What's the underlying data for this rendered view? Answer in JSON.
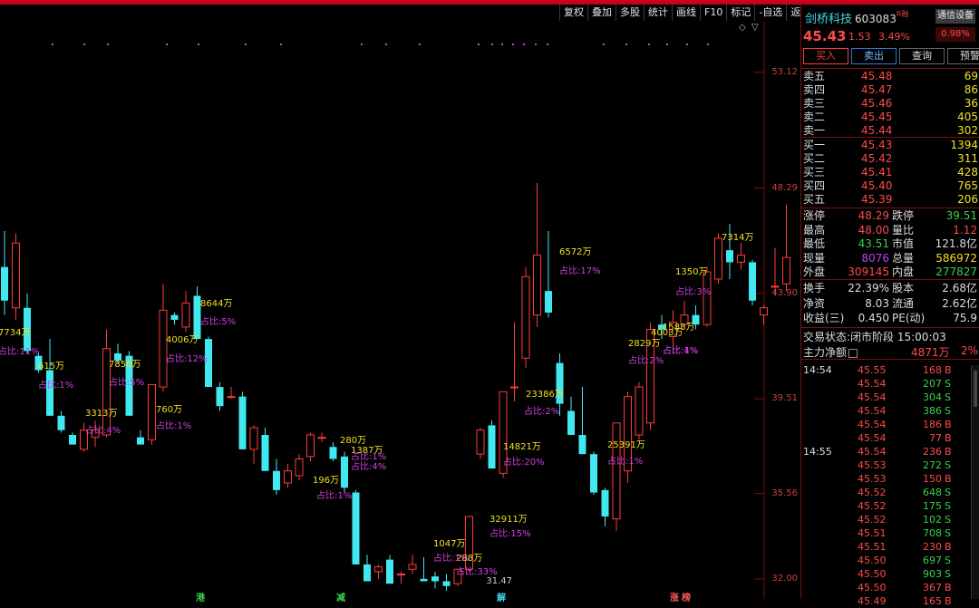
{
  "toolbar": [
    "复权",
    "叠加",
    "多股",
    "统计",
    "画线",
    "F10",
    "标记",
    "-自选",
    "返回"
  ],
  "chart": {
    "y_axis": [
      "53.12",
      "48.29",
      "43.90",
      "39.51",
      "35.56",
      "32.00"
    ],
    "low_label": "31.47",
    "bottom_markers": [
      {
        "text": "港",
        "color": "#3ad24a"
      },
      {
        "text": "减",
        "color": "#3ad24a"
      },
      {
        "text": "解",
        "color": "#42d9e8"
      },
      {
        "text": "涨",
        "color": "#ff5a5a"
      },
      {
        "text": "榜",
        "color": "#ff5a5a"
      }
    ],
    "annotations_vol": [
      "7734万",
      "615万",
      "7858万",
      "3313万",
      "760万",
      "4006万",
      "8644万",
      "280万",
      "1387万",
      "196万",
      "1047万",
      "288万",
      "32911万",
      "14821万",
      "23386万",
      "6572万",
      "25391万",
      "2829万",
      "4003万",
      "1588万",
      "1350万",
      "7314万"
    ],
    "annotations_pct": [
      "占比:11%",
      "占比:1%",
      "占比:5%",
      "占比:4%",
      "占比:1%",
      "占比:12%",
      "占比:5%",
      "占比:1%",
      "占比:4%",
      "占比:1%",
      "占比:1%",
      "占比:33%",
      "占比:15%",
      "占比:20%",
      "占比:2%",
      "占比:17%",
      "占比:1%",
      "占比:2%",
      "占比:1%",
      "占比:4%",
      "占比:3%"
    ]
  },
  "chart_data": {
    "type": "candlestick",
    "ylim": [
      31.2,
      55.0
    ],
    "candles": [
      {
        "o": 45.0,
        "h": 46.5,
        "l": 43.0,
        "c": 43.6
      },
      {
        "o": 43.3,
        "h": 46.4,
        "l": 42.8,
        "c": 46.0
      },
      {
        "o": 43.3,
        "h": 43.9,
        "l": 41.4,
        "c": 41.5
      },
      {
        "o": 41.3,
        "h": 41.4,
        "l": 40.6,
        "c": 40.7
      },
      {
        "o": 40.7,
        "h": 42.0,
        "l": 38.8,
        "c": 38.8
      },
      {
        "o": 38.8,
        "h": 39.0,
        "l": 38.1,
        "c": 38.2
      },
      {
        "o": 38.0,
        "h": 38.1,
        "l": 37.6,
        "c": 37.6
      },
      {
        "o": 37.4,
        "h": 38.5,
        "l": 37.3,
        "c": 38.2
      },
      {
        "o": 37.9,
        "h": 38.6,
        "l": 37.5,
        "c": 38.2
      },
      {
        "o": 38.0,
        "h": 42.4,
        "l": 37.9,
        "c": 41.6
      },
      {
        "o": 41.4,
        "h": 41.8,
        "l": 41.0,
        "c": 41.1
      },
      {
        "o": 41.3,
        "h": 41.5,
        "l": 38.8,
        "c": 38.8
      },
      {
        "o": 37.9,
        "h": 38.2,
        "l": 37.6,
        "c": 37.6
      },
      {
        "o": 37.8,
        "h": 40.1,
        "l": 37.6,
        "c": 40.1
      },
      {
        "o": 40.0,
        "h": 44.3,
        "l": 39.8,
        "c": 43.2
      },
      {
        "o": 43.0,
        "h": 43.1,
        "l": 42.6,
        "c": 42.8
      },
      {
        "o": 42.5,
        "h": 44.0,
        "l": 42.3,
        "c": 43.5
      },
      {
        "o": 43.8,
        "h": 44.2,
        "l": 42.0,
        "c": 42.0
      },
      {
        "o": 42.0,
        "h": 42.1,
        "l": 40.0,
        "c": 40.0
      },
      {
        "o": 40.0,
        "h": 40.2,
        "l": 39.0,
        "c": 39.2
      },
      {
        "o": 39.6,
        "h": 40.0,
        "l": 39.5,
        "c": 39.6
      },
      {
        "o": 39.6,
        "h": 39.8,
        "l": 37.4,
        "c": 37.4
      },
      {
        "o": 37.4,
        "h": 38.4,
        "l": 36.8,
        "c": 38.3
      },
      {
        "o": 38.0,
        "h": 38.3,
        "l": 36.5,
        "c": 36.5
      },
      {
        "o": 36.5,
        "h": 37.0,
        "l": 35.5,
        "c": 35.7
      },
      {
        "o": 36.0,
        "h": 36.8,
        "l": 35.8,
        "c": 36.5
      },
      {
        "o": 36.3,
        "h": 37.2,
        "l": 36.1,
        "c": 37.0
      },
      {
        "o": 37.1,
        "h": 38.1,
        "l": 36.9,
        "c": 38.0
      },
      {
        "o": 37.9,
        "h": 38.1,
        "l": 37.7,
        "c": 37.9
      },
      {
        "o": 37.5,
        "h": 37.7,
        "l": 36.9,
        "c": 37.0
      },
      {
        "o": 37.1,
        "h": 37.3,
        "l": 35.6,
        "c": 35.8
      },
      {
        "o": 35.6,
        "h": 35.7,
        "l": 32.6,
        "c": 32.6
      },
      {
        "o": 32.6,
        "h": 33.0,
        "l": 31.9,
        "c": 31.9
      },
      {
        "o": 32.3,
        "h": 32.6,
        "l": 32.0,
        "c": 32.5
      },
      {
        "o": 32.8,
        "h": 33.0,
        "l": 31.8,
        "c": 31.8
      },
      {
        "o": 32.2,
        "h": 32.3,
        "l": 31.8,
        "c": 32.2
      },
      {
        "o": 32.4,
        "h": 33.0,
        "l": 32.2,
        "c": 32.6
      },
      {
        "o": 32.0,
        "h": 32.9,
        "l": 31.9,
        "c": 31.9
      },
      {
        "o": 32.1,
        "h": 32.3,
        "l": 31.6,
        "c": 31.9
      },
      {
        "o": 31.9,
        "h": 32.2,
        "l": 31.5,
        "c": 31.7
      },
      {
        "o": 31.8,
        "h": 32.4,
        "l": 31.7,
        "c": 32.4
      },
      {
        "o": 32.4,
        "h": 34.6,
        "l": 32.3,
        "c": 34.6
      },
      {
        "o": 37.2,
        "h": 38.3,
        "l": 37.0,
        "c": 38.2
      },
      {
        "o": 38.4,
        "h": 38.6,
        "l": 36.6,
        "c": 36.6
      },
      {
        "o": 36.4,
        "h": 39.8,
        "l": 36.2,
        "c": 39.8
      },
      {
        "o": 40.0,
        "h": 42.7,
        "l": 39.4,
        "c": 40.0
      },
      {
        "o": 41.2,
        "h": 45.0,
        "l": 40.8,
        "c": 44.6
      },
      {
        "o": 43.0,
        "h": 48.5,
        "l": 42.5,
        "c": 45.5
      },
      {
        "o": 44.0,
        "h": 46.5,
        "l": 42.9,
        "c": 43.1
      },
      {
        "o": 41.0,
        "h": 41.4,
        "l": 38.8,
        "c": 39.3
      },
      {
        "o": 39.0,
        "h": 39.6,
        "l": 38.0,
        "c": 38.0
      },
      {
        "o": 38.0,
        "h": 40.0,
        "l": 37.2,
        "c": 37.2
      },
      {
        "o": 37.2,
        "h": 37.3,
        "l": 35.5,
        "c": 35.6
      },
      {
        "o": 35.7,
        "h": 35.8,
        "l": 34.2,
        "c": 34.6
      },
      {
        "o": 34.5,
        "h": 38.5,
        "l": 34.0,
        "c": 38.5
      },
      {
        "o": 36.5,
        "h": 39.8,
        "l": 36.0,
        "c": 39.6
      },
      {
        "o": 38.0,
        "h": 40.2,
        "l": 37.8,
        "c": 40.0
      },
      {
        "o": 38.5,
        "h": 42.7,
        "l": 38.2,
        "c": 42.4
      },
      {
        "o": 42.6,
        "h": 43.0,
        "l": 42.0,
        "c": 42.4
      },
      {
        "o": 42.1,
        "h": 43.2,
        "l": 41.4,
        "c": 42.7
      },
      {
        "o": 42.6,
        "h": 43.6,
        "l": 42.4,
        "c": 43.0
      },
      {
        "o": 43.0,
        "h": 43.4,
        "l": 42.4,
        "c": 42.6
      },
      {
        "o": 42.6,
        "h": 45.0,
        "l": 42.5,
        "c": 44.8
      },
      {
        "o": 44.5,
        "h": 46.4,
        "l": 44.3,
        "c": 46.2
      },
      {
        "o": 45.7,
        "h": 46.8,
        "l": 44.5,
        "c": 45.2
      },
      {
        "o": 45.2,
        "h": 46.0,
        "l": 44.9,
        "c": 45.5
      },
      {
        "o": 45.2,
        "h": 45.3,
        "l": 43.4,
        "c": 43.6
      },
      {
        "o": 43.0,
        "h": 43.4,
        "l": 42.6,
        "c": 43.3
      },
      {
        "o": 44.2,
        "h": 45.8,
        "l": 43.8,
        "c": 44.2
      },
      {
        "o": 44.3,
        "h": 47.6,
        "l": 44.0,
        "c": 45.4
      }
    ]
  },
  "stock": {
    "name": "剑桥科技",
    "code": "603083",
    "market_tag": "R融",
    "badge": "通信设备",
    "price": "45.43",
    "change": "1.53",
    "change_pct": "3.49%",
    "badge_pct": "0.98%"
  },
  "buttons": {
    "buy": "买入",
    "sell": "卖出",
    "query": "查询",
    "alert": "预警"
  },
  "sell_orders": [
    {
      "label": "卖五",
      "price": "45.48",
      "vol": "69"
    },
    {
      "label": "卖四",
      "price": "45.47",
      "vol": "86"
    },
    {
      "label": "卖三",
      "price": "45.46",
      "vol": "36"
    },
    {
      "label": "卖二",
      "price": "45.45",
      "vol": "405"
    },
    {
      "label": "卖一",
      "price": "45.44",
      "vol": "302"
    }
  ],
  "buy_orders": [
    {
      "label": "买一",
      "price": "45.43",
      "vol": "1394"
    },
    {
      "label": "买二",
      "price": "45.42",
      "vol": "311"
    },
    {
      "label": "买三",
      "price": "45.41",
      "vol": "428"
    },
    {
      "label": "买四",
      "price": "45.40",
      "vol": "765"
    },
    {
      "label": "买五",
      "price": "45.39",
      "vol": "206"
    }
  ],
  "stats": [
    {
      "k1": "涨停",
      "v1": "48.29",
      "c1": "#ff4a4a",
      "k2": "跌停",
      "v2": "39.51",
      "c2": "#3ad24a"
    },
    {
      "k1": "最高",
      "v1": "48.00",
      "c1": "#ff4a4a",
      "k2": "量比",
      "v2": "1.12",
      "c2": "#ff4a4a"
    },
    {
      "k1": "最低",
      "v1": "43.51",
      "c1": "#3ad24a",
      "k2": "市值",
      "v2": "121.8亿",
      "c2": "#dddddd"
    },
    {
      "k1": "现量",
      "v1": "8076",
      "c1": "#c040f0",
      "k2": "总量",
      "v2": "586972",
      "c2": "#f0e020"
    },
    {
      "k1": "外盘",
      "v1": "309145",
      "c1": "#ff4a4a",
      "k2": "内盘",
      "v2": "277827",
      "c2": "#3ad24a"
    }
  ],
  "fund": [
    {
      "k1": "换手",
      "v1": "22.39%",
      "k2": "股本",
      "v2": "2.68亿"
    },
    {
      "k1": "净资",
      "v1": "8.03",
      "k2": "流通",
      "v2": "2.62亿"
    },
    {
      "k1": "收益(三)",
      "v1": "0.450",
      "k2": "PE(动)",
      "v2": "75.9"
    }
  ],
  "status": {
    "label": "交易状态:",
    "value": "闭市阶段 15:00:03"
  },
  "main_flow": {
    "label": "主力净额",
    "value": "4871万",
    "pct": "2%"
  },
  "ticks": [
    {
      "time": "14:54",
      "price": "45.55",
      "vol": "168",
      "flag": "B"
    },
    {
      "time": "",
      "price": "45.54",
      "vol": "207",
      "flag": "S"
    },
    {
      "time": "",
      "price": "45.54",
      "vol": "304",
      "flag": "S"
    },
    {
      "time": "",
      "price": "45.54",
      "vol": "386",
      "flag": "S"
    },
    {
      "time": "",
      "price": "45.54",
      "vol": "186",
      "flag": "B"
    },
    {
      "time": "",
      "price": "45.54",
      "vol": "77",
      "flag": "B"
    },
    {
      "time": "14:55",
      "price": "45.54",
      "vol": "236",
      "flag": "B"
    },
    {
      "time": "",
      "price": "45.53",
      "vol": "272",
      "flag": "S"
    },
    {
      "time": "",
      "price": "45.53",
      "vol": "150",
      "flag": "B"
    },
    {
      "time": "",
      "price": "45.52",
      "vol": "648",
      "flag": "S"
    },
    {
      "time": "",
      "price": "45.52",
      "vol": "175",
      "flag": "S"
    },
    {
      "time": "",
      "price": "45.52",
      "vol": "102",
      "flag": "S"
    },
    {
      "time": "",
      "price": "45.51",
      "vol": "708",
      "flag": "S"
    },
    {
      "time": "",
      "price": "45.51",
      "vol": "230",
      "flag": "B"
    },
    {
      "time": "",
      "price": "45.50",
      "vol": "697",
      "flag": "S"
    },
    {
      "time": "",
      "price": "45.50",
      "vol": "903",
      "flag": "S"
    },
    {
      "time": "",
      "price": "45.50",
      "vol": "367",
      "flag": "B"
    },
    {
      "time": "",
      "price": "45.49",
      "vol": "165",
      "flag": "B"
    }
  ]
}
